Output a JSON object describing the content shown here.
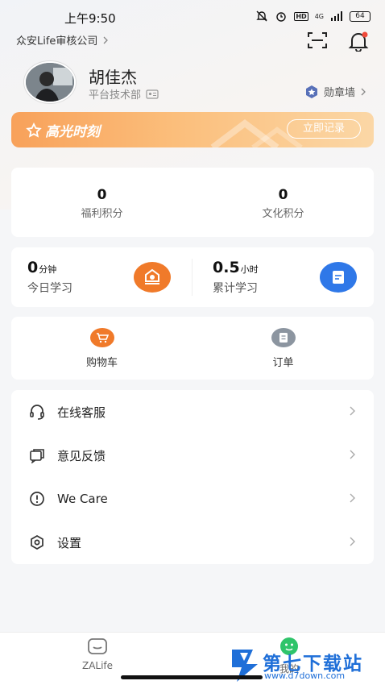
{
  "status_bar": {
    "time": "上午9:50",
    "battery": "64",
    "network": "4G"
  },
  "header": {
    "company": "众安Life审核公司"
  },
  "profile": {
    "name": "胡佳杰",
    "department": "平台技术部",
    "badge_wall": "勋章墙"
  },
  "highlight": {
    "title": "高光时刻",
    "record_button": "立即记录"
  },
  "points": [
    {
      "value": "0",
      "label": "福利积分"
    },
    {
      "value": "0",
      "label": "文化积分"
    }
  ],
  "study": [
    {
      "value": "0",
      "unit": "分钟",
      "label": "今日学习",
      "color": "#f07a2a"
    },
    {
      "value": "0.5",
      "unit": "小时",
      "label": "累计学习",
      "color": "#2f78e8"
    }
  ],
  "shop": [
    {
      "label": "购物车",
      "icon": "cart-icon",
      "color": "#f07a2a"
    },
    {
      "label": "订单",
      "icon": "order-icon",
      "color": "#8c95a0"
    }
  ],
  "menu": [
    {
      "label": "在线客服",
      "icon": "headset-icon"
    },
    {
      "label": "意见反馈",
      "icon": "feedback-icon"
    },
    {
      "label": "We Care",
      "icon": "alert-circle-icon"
    },
    {
      "label": "设置",
      "icon": "settings-icon"
    }
  ],
  "tabbar": [
    {
      "label": "ZALife",
      "icon": "home-icon"
    },
    {
      "label": "我的",
      "icon": "profile-icon"
    }
  ],
  "watermark": {
    "title": "第七下载站",
    "url": "www.d7down.com"
  }
}
